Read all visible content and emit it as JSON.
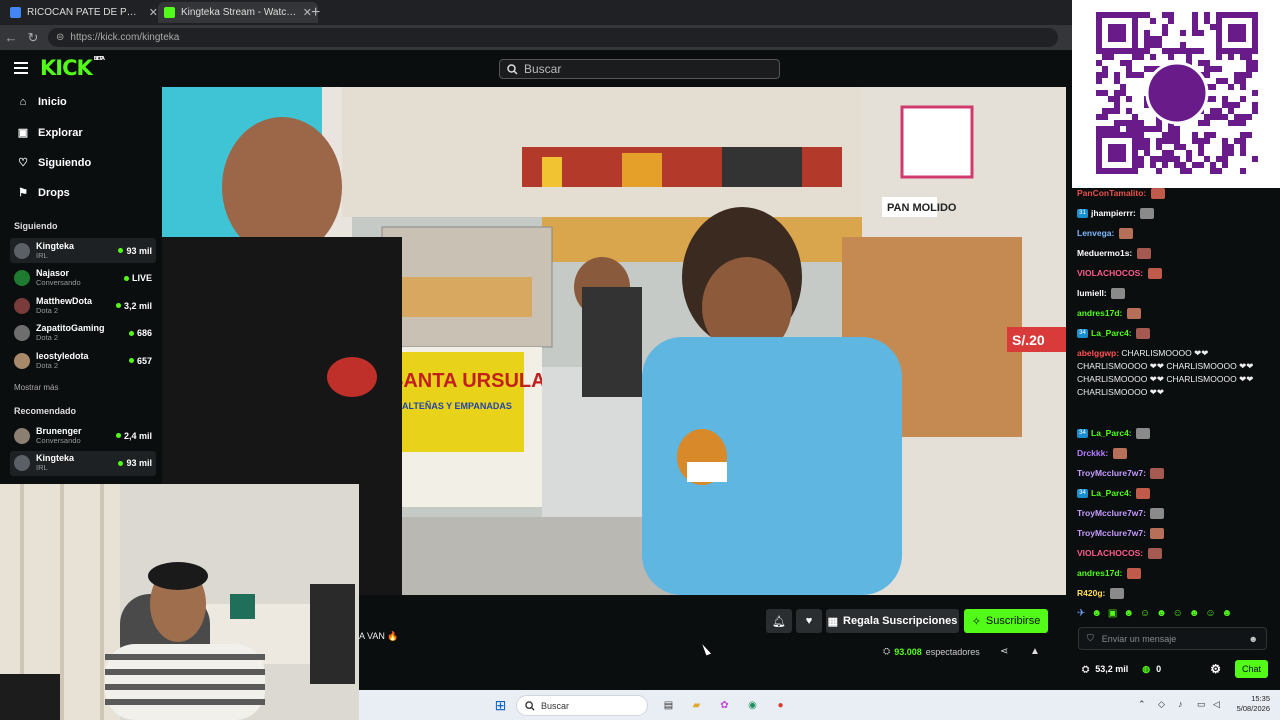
{
  "browser": {
    "tabs": [
      {
        "title": "RICOCAN PATE DE POLLO - Búsqu",
        "fav_color": "#4285f4",
        "active": false
      },
      {
        "title": "Kingteka Stream - Watch Live",
        "fav_color": "#53fc18",
        "active": true
      }
    ],
    "url": "https://kick.com/kingteka"
  },
  "header": {
    "logo": "KICK",
    "logo_sup": "BETA",
    "search_placeholder": "Buscar"
  },
  "sidebar": {
    "nav": [
      {
        "label": "Inicio",
        "icon": "home-icon",
        "glyph": "⌂"
      },
      {
        "label": "Explorar",
        "icon": "compass-icon",
        "glyph": "▣"
      },
      {
        "label": "Siguiendo",
        "icon": "heart-icon",
        "glyph": "♡"
      },
      {
        "label": "Drops",
        "icon": "drops-icon",
        "glyph": "⚑"
      }
    ],
    "following_title": "Siguiendo",
    "following": [
      {
        "name": "Kingteka",
        "category": "IRL",
        "viewers": "93 mil",
        "color": "#5a6066"
      },
      {
        "name": "Najasor",
        "category": "Conversando",
        "viewers": "LIVE",
        "color": "#1e7a2e"
      },
      {
        "name": "MatthewDota",
        "category": "Dota 2",
        "viewers": "3,2 mil",
        "color": "#7a3b3b"
      },
      {
        "name": "ZapatitoGaming",
        "category": "Dota 2",
        "viewers": "686",
        "color": "#6e6e6e"
      },
      {
        "name": "leostyledota",
        "category": "Dota 2",
        "viewers": "657",
        "color": "#a88a6a"
      }
    ],
    "show_more": "Mostrar más",
    "recommended_title": "Recomendado",
    "recommended": [
      {
        "name": "Brunenger",
        "category": "Conversando",
        "viewers": "2,4 mil",
        "color": "#8a7f70"
      },
      {
        "name": "Kingteka",
        "category": "IRL",
        "viewers": "93 mil",
        "color": "#5a6066"
      }
    ]
  },
  "stream": {
    "title_fragment": "A VAN 🔥",
    "gift_label": "Regala Suscripciones",
    "subscribe_label": "Suscribirse",
    "viewer_count": "93.008",
    "viewer_suffix": "espectadores",
    "video_signs": {
      "store_name": "SANTA URSULA",
      "store_sub": "SALTEÑAS Y EMPANADAS",
      "bread_sign": "PAN MOLIDO",
      "price_sign": "S/.20"
    }
  },
  "chat": {
    "messages": [
      {
        "user": "PanConTamalito:",
        "color": "#e8524a",
        "badge": "",
        "text": ""
      },
      {
        "user": "jhampierrr:",
        "color": "#ffffff",
        "badge": "31",
        "text": ""
      },
      {
        "user": "Lenvega:",
        "color": "#7fb8ff",
        "badge": "",
        "text": ""
      },
      {
        "user": "Meduermo1s:",
        "color": "#ffffff",
        "badge": "",
        "text": ""
      },
      {
        "user": "VIOLACHOCOS:",
        "color": "#ff5c8a",
        "badge": "",
        "text": ""
      },
      {
        "user": "lumiell:",
        "color": "#ffffff",
        "badge": "",
        "text": ""
      },
      {
        "user": "andres17d:",
        "color": "#53fc18",
        "badge": "",
        "text": ""
      },
      {
        "user": "La_Parc4:",
        "color": "#53fc18",
        "badge": "34",
        "text": ""
      },
      {
        "user": "abelggwp:",
        "color": "#ff4f4f",
        "badge": "",
        "text": "CHARLISMOOOO ❤❤ CHARLISMOOOO ❤❤ CHARLISMOOOO ❤❤ CHARLISMOOOO ❤❤ CHARLISMOOOO ❤❤ CHARLISMOOOO ❤❤"
      },
      {
        "user": "La_Parc4:",
        "color": "#53fc18",
        "badge": "34",
        "text": ""
      },
      {
        "user": "Drckkk:",
        "color": "#b47cff",
        "badge": "",
        "text": ""
      },
      {
        "user": "TroyMcclure7w7:",
        "color": "#c79bff",
        "badge": "",
        "text": ""
      },
      {
        "user": "La_Parc4:",
        "color": "#53fc18",
        "badge": "34",
        "text": ""
      },
      {
        "user": "TroyMcclure7w7:",
        "color": "#c79bff",
        "badge": "",
        "text": ""
      },
      {
        "user": "TroyMcclure7w7:",
        "color": "#c79bff",
        "badge": "",
        "text": ""
      },
      {
        "user": "VIOLACHOCOS:",
        "color": "#ff5c8a",
        "badge": "",
        "text": ""
      },
      {
        "user": "andres17d:",
        "color": "#53fc18",
        "badge": "",
        "text": ""
      },
      {
        "user": "R420g:",
        "color": "#ffdd55",
        "badge": "",
        "text": ""
      }
    ],
    "input_placeholder": "Enviar un mensaje",
    "points": "53,2 mil",
    "kick_points": "0",
    "chat_button": "Chat"
  },
  "taskbar": {
    "search_placeholder": "Buscar",
    "time": "15:35",
    "date": "5/08/2026"
  },
  "colors": {
    "accent": "#53fc18",
    "bg": "#0b0e0f"
  }
}
